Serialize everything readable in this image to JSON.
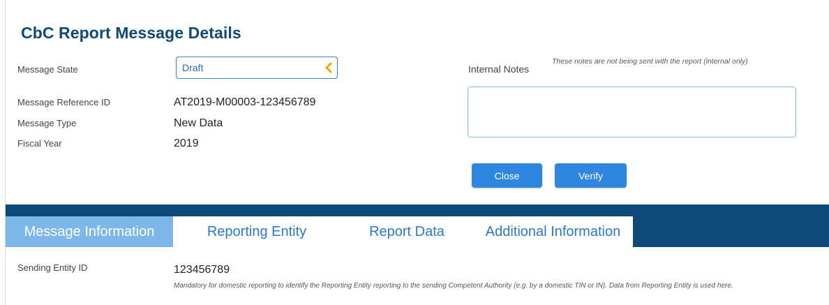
{
  "page": {
    "title": "CbC Report Message Details"
  },
  "fields": {
    "message_state": {
      "label": "Message State",
      "value": "Draft"
    },
    "message_reference_id": {
      "label": "Message Reference ID",
      "value": "AT2019-M00003-123456789"
    },
    "message_type": {
      "label": "Message Type",
      "value": "New Data"
    },
    "fiscal_year": {
      "label": "Fiscal Year",
      "value": "2019"
    }
  },
  "notes": {
    "label": "Internal Notes",
    "hint": "These notes are not being sent with the report (internal only)",
    "value": ""
  },
  "actions": {
    "close_label": "Close",
    "verify_label": "Verify"
  },
  "tabs": [
    {
      "label": "Message Information",
      "active": true
    },
    {
      "label": "Reporting Entity",
      "active": false
    },
    {
      "label": "Report Data",
      "active": false
    },
    {
      "label": "Additional Information",
      "active": false
    }
  ],
  "message_information": {
    "sending_entity": {
      "label": "Sending Entity ID",
      "value": "123456789",
      "hint": "Mandatory for domestic reporting to identify the Reporting Entity reporting to the sending Competent Authority (e.g. by a domestic TIN or IN). Data from Reporting Entity is used here."
    }
  },
  "colors": {
    "title": "#0d4a7a",
    "tab_bar": "#0d4a7a",
    "tab_active_bg": "#7db7e9",
    "tab_text": "#2a78cf",
    "button": "#2e86e0",
    "chevron": "#f0a500"
  },
  "icons": {
    "state_dropdown": "chevron-left-icon"
  }
}
